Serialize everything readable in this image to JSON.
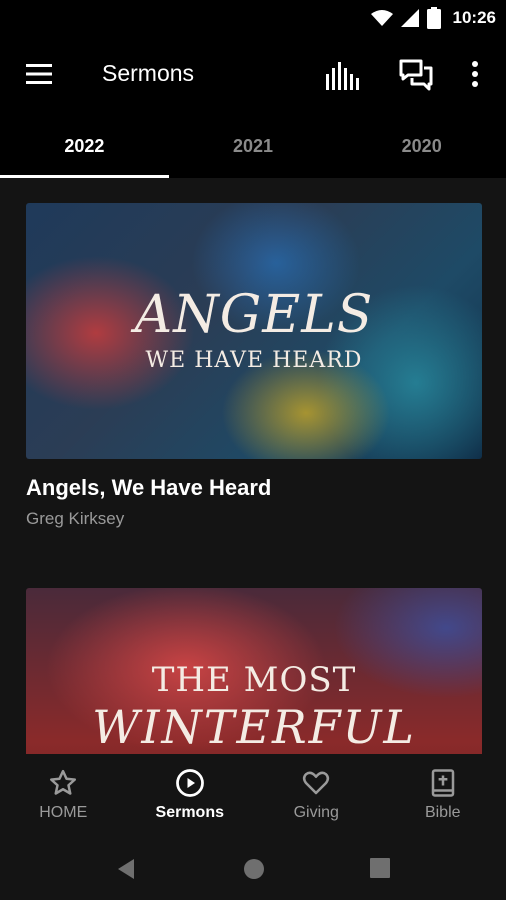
{
  "status_bar": {
    "time": "10:26",
    "icons": [
      "wifi-icon",
      "cell-signal-icon",
      "battery-icon"
    ]
  },
  "app_bar": {
    "title": "Sermons",
    "actions": [
      "menu-icon",
      "equalizer-icon",
      "chat-icon",
      "more-vert-icon"
    ]
  },
  "tabs": [
    {
      "label": "2022",
      "active": true
    },
    {
      "label": "2021",
      "active": false
    },
    {
      "label": "2020",
      "active": false
    }
  ],
  "sermons": [
    {
      "title": "Angels, We Have Heard",
      "speaker": "Greg Kirksey",
      "artwork_line1": "ANGELS",
      "artwork_line2": "WE HAVE HEARD"
    },
    {
      "artwork_line1": "THE MOST",
      "artwork_line2": "WINTERFUL"
    }
  ],
  "bottom_nav": [
    {
      "label": "HOME",
      "icon": "star-icon",
      "active": false
    },
    {
      "label": "Sermons",
      "icon": "play-circle-icon",
      "active": true
    },
    {
      "label": "Giving",
      "icon": "heart-icon",
      "active": false
    },
    {
      "label": "Bible",
      "icon": "bible-icon",
      "active": false
    }
  ],
  "system_nav": [
    "back-icon",
    "home-icon",
    "recents-icon"
  ],
  "colors": {
    "background": "#141414",
    "bar": "#000000",
    "text_primary": "#ffffff",
    "text_secondary": "#9a9a9a"
  }
}
